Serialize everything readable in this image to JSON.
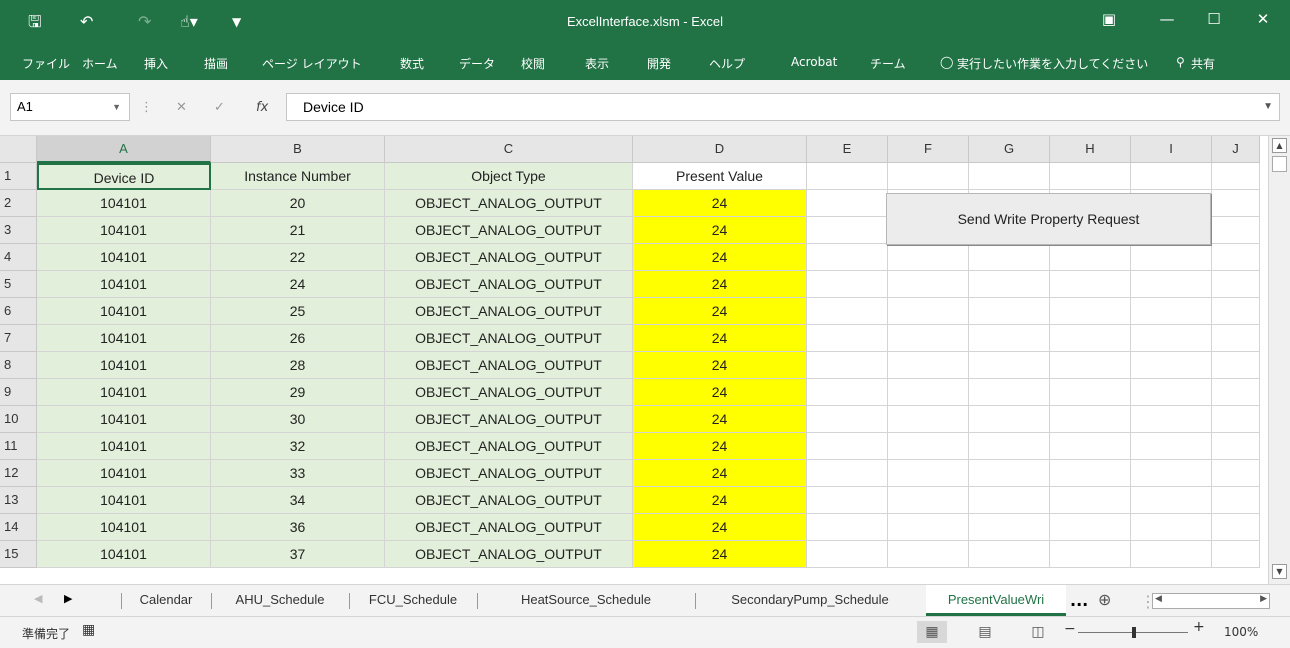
{
  "window": {
    "title": "ExcelInterface.xlsm  -  Excel"
  },
  "menu": [
    "ファイル",
    "ホーム",
    "挿入",
    "描画",
    "ページ レイアウト",
    "数式",
    "データ",
    "校閲",
    "表示",
    "開発",
    "ヘルプ",
    "Acrobat",
    "チーム"
  ],
  "tellme": "実行したい作業を入力してください",
  "share": "共有",
  "namebox": "A1",
  "formula": "Device ID",
  "columns": [
    "A",
    "B",
    "C",
    "D",
    "E",
    "F",
    "G",
    "H",
    "I",
    "J"
  ],
  "headers": [
    "Device ID",
    "Instance Number",
    "Object Type",
    "Present Value"
  ],
  "rows": [
    [
      "1",
      "Device ID",
      "Instance Number",
      "Object Type",
      "Present Value"
    ],
    [
      "2",
      "104101",
      "20",
      "OBJECT_ANALOG_OUTPUT",
      "24"
    ],
    [
      "3",
      "104101",
      "21",
      "OBJECT_ANALOG_OUTPUT",
      "24"
    ],
    [
      "4",
      "104101",
      "22",
      "OBJECT_ANALOG_OUTPUT",
      "24"
    ],
    [
      "5",
      "104101",
      "24",
      "OBJECT_ANALOG_OUTPUT",
      "24"
    ],
    [
      "6",
      "104101",
      "25",
      "OBJECT_ANALOG_OUTPUT",
      "24"
    ],
    [
      "7",
      "104101",
      "26",
      "OBJECT_ANALOG_OUTPUT",
      "24"
    ],
    [
      "8",
      "104101",
      "28",
      "OBJECT_ANALOG_OUTPUT",
      "24"
    ],
    [
      "9",
      "104101",
      "29",
      "OBJECT_ANALOG_OUTPUT",
      "24"
    ],
    [
      "10",
      "104101",
      "30",
      "OBJECT_ANALOG_OUTPUT",
      "24"
    ],
    [
      "11",
      "104101",
      "32",
      "OBJECT_ANALOG_OUTPUT",
      "24"
    ],
    [
      "12",
      "104101",
      "33",
      "OBJECT_ANALOG_OUTPUT",
      "24"
    ],
    [
      "13",
      "104101",
      "34",
      "OBJECT_ANALOG_OUTPUT",
      "24"
    ],
    [
      "14",
      "104101",
      "36",
      "OBJECT_ANALOG_OUTPUT",
      "24"
    ],
    [
      "15",
      "104101",
      "37",
      "OBJECT_ANALOG_OUTPUT",
      "24"
    ]
  ],
  "button": {
    "label": "Send Write Property Request"
  },
  "sheets": [
    "Calendar",
    "AHU_Schedule",
    "FCU_Schedule",
    "HeatSource_Schedule",
    "SecondaryPump_Schedule",
    "PresentValueWri"
  ],
  "sheets_more": "...",
  "status": {
    "ready": "準備完了",
    "zoom": "100%"
  },
  "colors": {
    "excel_green": "#217346",
    "cell_green": "#e2efda",
    "cell_yellow": "#ffff00"
  }
}
